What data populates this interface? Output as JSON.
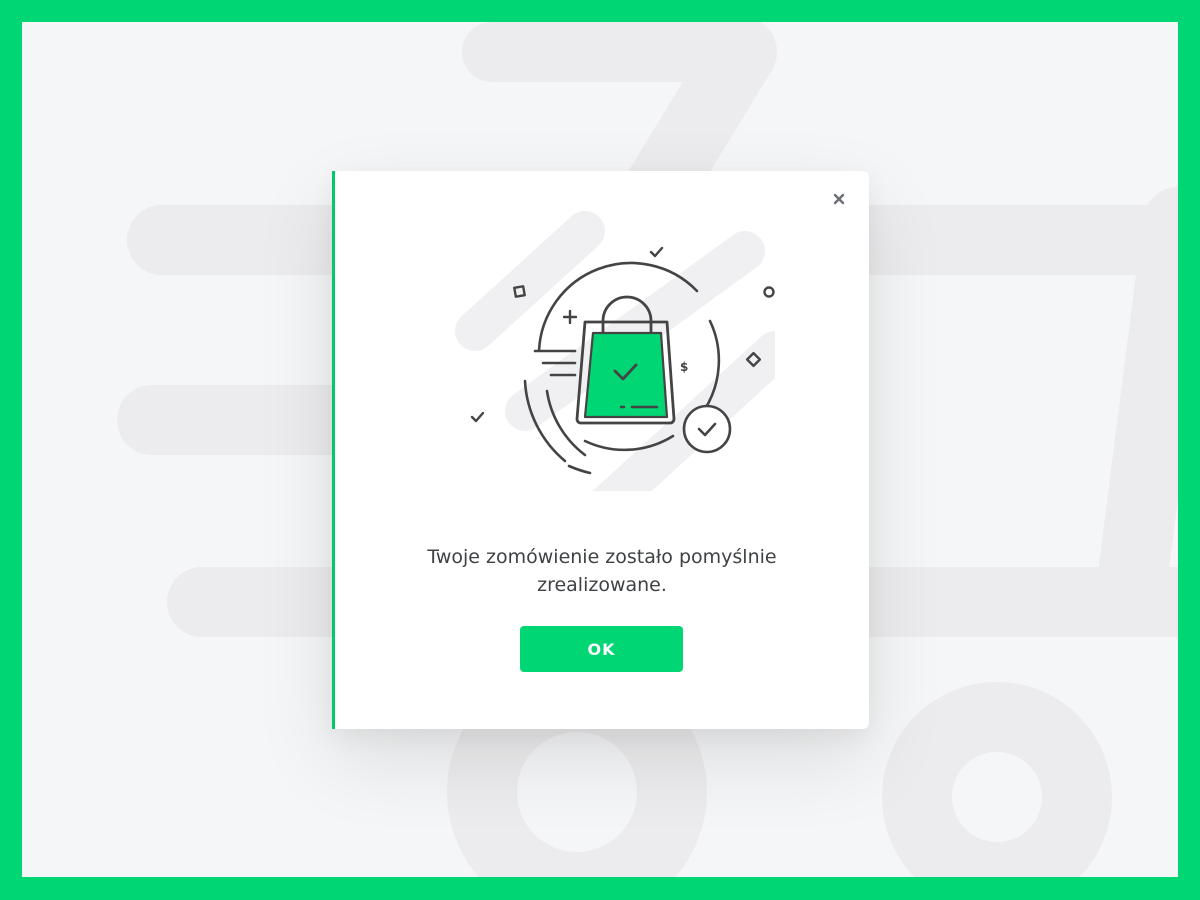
{
  "colors": {
    "frame": "#00d674",
    "accent": "#00d674",
    "background": "#f5f6f7",
    "text": "#3f4245",
    "icon_stroke": "#444444"
  },
  "modal": {
    "close_icon": "close-icon",
    "illustration_icon": "shopping-bag-success-icon",
    "currency_symbol": "$",
    "message": "Twoje zomówienie zostało pomyślnie zrealizowane.",
    "ok_label": "OK"
  }
}
